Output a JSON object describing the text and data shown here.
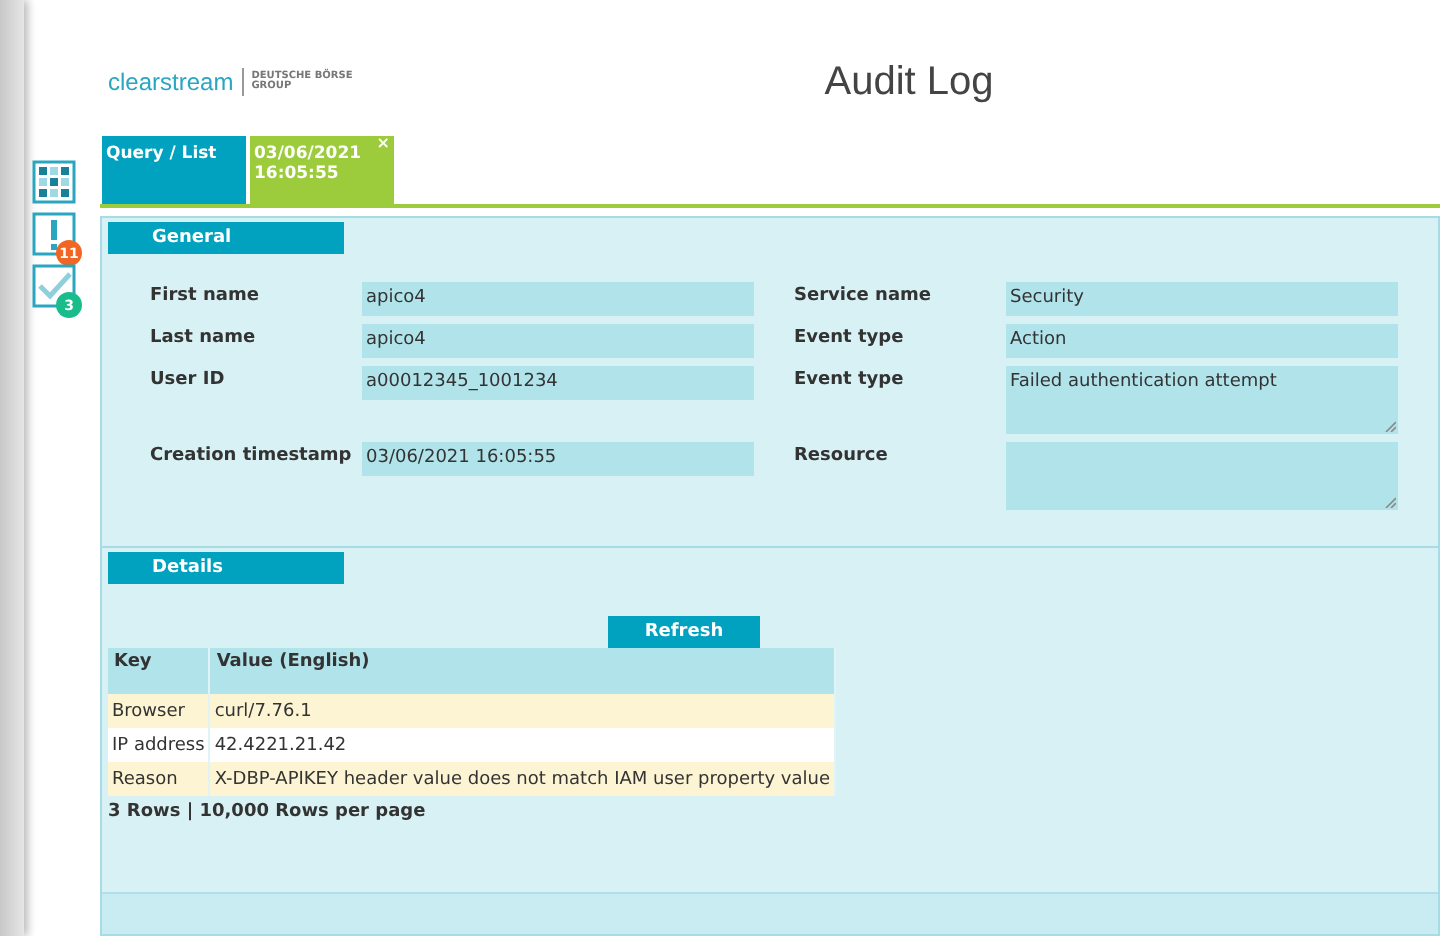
{
  "logo": {
    "name": "clearstream",
    "group_line1": "DEUTSCHE BÖRSE",
    "group_line2": "GROUP"
  },
  "title": "Audit Log",
  "sidebar": [
    {
      "kind": "grid"
    },
    {
      "kind": "alert",
      "badge": "11",
      "color": "#f26522"
    },
    {
      "kind": "check",
      "badge": "3",
      "color": "#1abc8c"
    }
  ],
  "tabs": [
    {
      "label": "Query / List",
      "selected": false
    },
    {
      "label": "03/06/2021\n16:05:55",
      "selected": true,
      "close": "×"
    }
  ],
  "general": {
    "title": "General",
    "left": [
      {
        "label": "First name",
        "value": "apico4",
        "kind": "line"
      },
      {
        "label": "Last name",
        "value": "apico4",
        "kind": "line"
      },
      {
        "label": "User ID",
        "value": "a00012345_1001234",
        "kind": "line"
      },
      {
        "label": "Creation timestamp",
        "value": "03/06/2021 16:05:55",
        "kind": "line"
      }
    ],
    "right": [
      {
        "label": "Service name",
        "value": "Security",
        "kind": "line"
      },
      {
        "label": "Event type",
        "value": "Action",
        "kind": "line"
      },
      {
        "label": "Event type",
        "value": "Failed authentication attempt",
        "kind": "area"
      },
      {
        "label": "Resource",
        "kind": "area"
      }
    ]
  },
  "details": {
    "title": "Details",
    "refresh": "Refresh",
    "columns": [
      "Key",
      "Value (English)"
    ],
    "rows": [
      [
        "Browser",
        "curl/7.76.1"
      ],
      [
        "IP address",
        "42.4221.21.42"
      ],
      [
        "Reason",
        "X-DBP-APIKEY header value does not match IAM user property value"
      ]
    ],
    "footer": "3 Rows | 10,000 Rows per page"
  }
}
